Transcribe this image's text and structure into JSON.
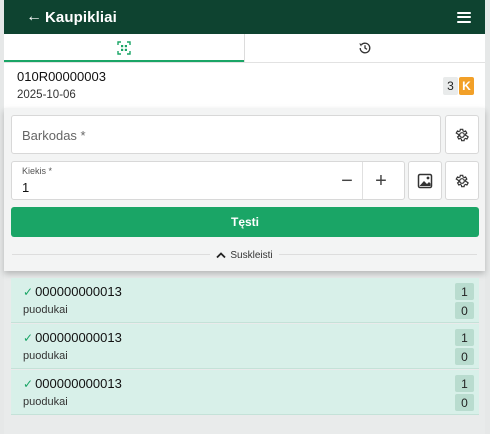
{
  "header": {
    "back_arrow": "←",
    "title": "Kaupikliai",
    "menu_icon": "hamburger-icon"
  },
  "tabs": [
    {
      "icon": "qr-scan-icon",
      "active": true
    },
    {
      "icon": "history-icon",
      "active": false
    }
  ],
  "document": {
    "number": "010R00000003",
    "date": "2025-10-06",
    "count": "3",
    "badge": "K"
  },
  "form": {
    "barcode_placeholder": "Barkodas *",
    "quantity_label": "Kiekis *",
    "quantity_value": "1",
    "minus": "−",
    "plus": "+",
    "continue_label": "Tęsti",
    "collapse_label": "Suskleisti"
  },
  "items": [
    {
      "code": "000000000013",
      "name": "puodukai",
      "count_a": "1",
      "count_b": "0"
    },
    {
      "code": "000000000013",
      "name": "puodukai",
      "count_a": "1",
      "count_b": "0"
    },
    {
      "code": "000000000013",
      "name": "puodukai",
      "count_a": "1",
      "count_b": "0"
    }
  ],
  "colors": {
    "header": "#0e4330",
    "accent": "#1aa566",
    "badge": "#f2a028",
    "row_bg": "#d8f0e9"
  }
}
